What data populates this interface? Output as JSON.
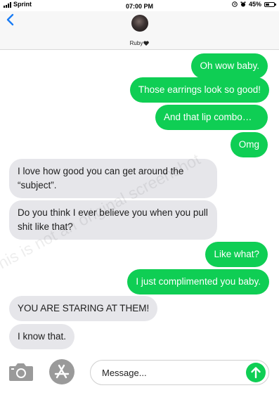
{
  "status_bar": {
    "carrier": "Sprint",
    "time": "07:00 PM",
    "battery": "45%",
    "battery_level": 0.45
  },
  "header": {
    "contact_name": "Ruby"
  },
  "messages": [
    {
      "direction": "sent",
      "text": "Oh wow baby."
    },
    {
      "direction": "sent",
      "text": "Those earrings look so good!"
    },
    {
      "direction": "sent",
      "text": "And that lip combo…"
    },
    {
      "direction": "sent",
      "text": "Omg"
    },
    {
      "direction": "received",
      "text": "I love how good you can get around the “subject”."
    },
    {
      "direction": "received",
      "text": "Do you think I ever believe you when you pull shit like that?"
    },
    {
      "direction": "sent",
      "text": "Like what?"
    },
    {
      "direction": "sent",
      "text": "I just complimented you baby."
    },
    {
      "direction": "received",
      "text": "YOU ARE STARING AT THEM!"
    },
    {
      "direction": "received",
      "text": "I know that."
    }
  ],
  "watermark": "This is not an original screenshot",
  "input": {
    "placeholder": "Message..."
  },
  "colors": {
    "sent_bubble": "#0fce54",
    "received_bubble": "#e6e6ea",
    "accent_blue": "#1a7cf5"
  }
}
